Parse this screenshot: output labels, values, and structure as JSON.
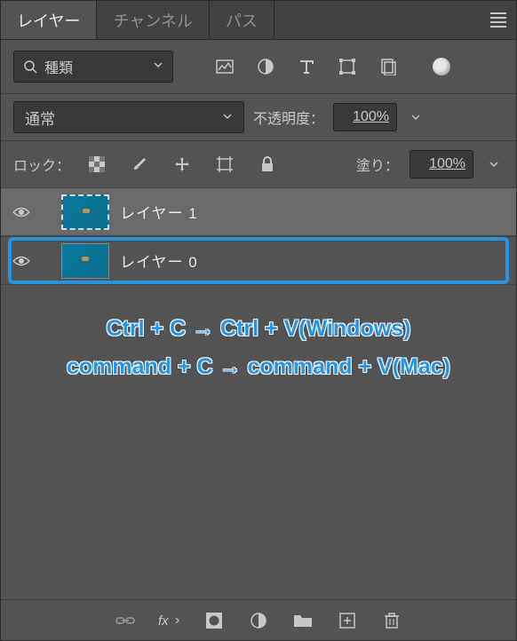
{
  "tabs": {
    "layers": "レイヤー",
    "channels": "チャンネル",
    "paths": "パス"
  },
  "filter": {
    "search_icon": "search",
    "label": "種類"
  },
  "blend": {
    "mode": "通常",
    "opacity_label": "不透明度：",
    "opacity_value": "100%"
  },
  "lock": {
    "label": "ロック：",
    "fill_label": "塗り：",
    "fill_value": "100%"
  },
  "layers": [
    {
      "name": "レイヤー 1",
      "selected": true,
      "copied_thumb": true
    },
    {
      "name": "レイヤー 0",
      "selected": false,
      "highlighted": true
    }
  ],
  "overlay": {
    "line1": "Ctrl + C → Ctrl + V(Windows)",
    "line2": "command + C → command + V(Mac)"
  }
}
